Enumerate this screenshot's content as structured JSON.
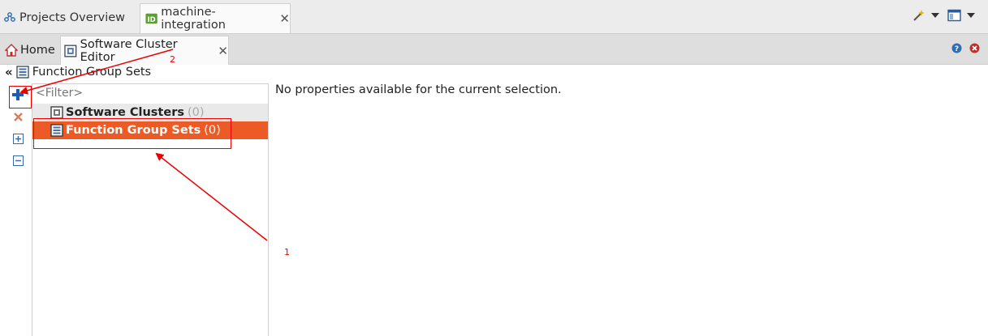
{
  "top_tabs": [
    {
      "label": "Projects Overview"
    },
    {
      "label": "machine-integration"
    }
  ],
  "editor_tabs": [
    {
      "label": "Home"
    },
    {
      "label": "Software Cluster Editor"
    }
  ],
  "breadcrumb": {
    "label": "Function Group Sets"
  },
  "filter": {
    "placeholder": "<Filter>"
  },
  "tree": {
    "items": [
      {
        "label": "Software Clusters",
        "count": "(0)"
      },
      {
        "label": "Function Group Sets",
        "count": "(0)"
      }
    ]
  },
  "properties": {
    "message": "No properties available for the current selection."
  },
  "annotations": {
    "label_1": "1",
    "label_2": "2"
  },
  "colors": {
    "selection": "#ec5a25",
    "annotation": "#e00000",
    "toolbar_add": "#1a5fb4",
    "toolbar_remove": "#e05a3c"
  }
}
